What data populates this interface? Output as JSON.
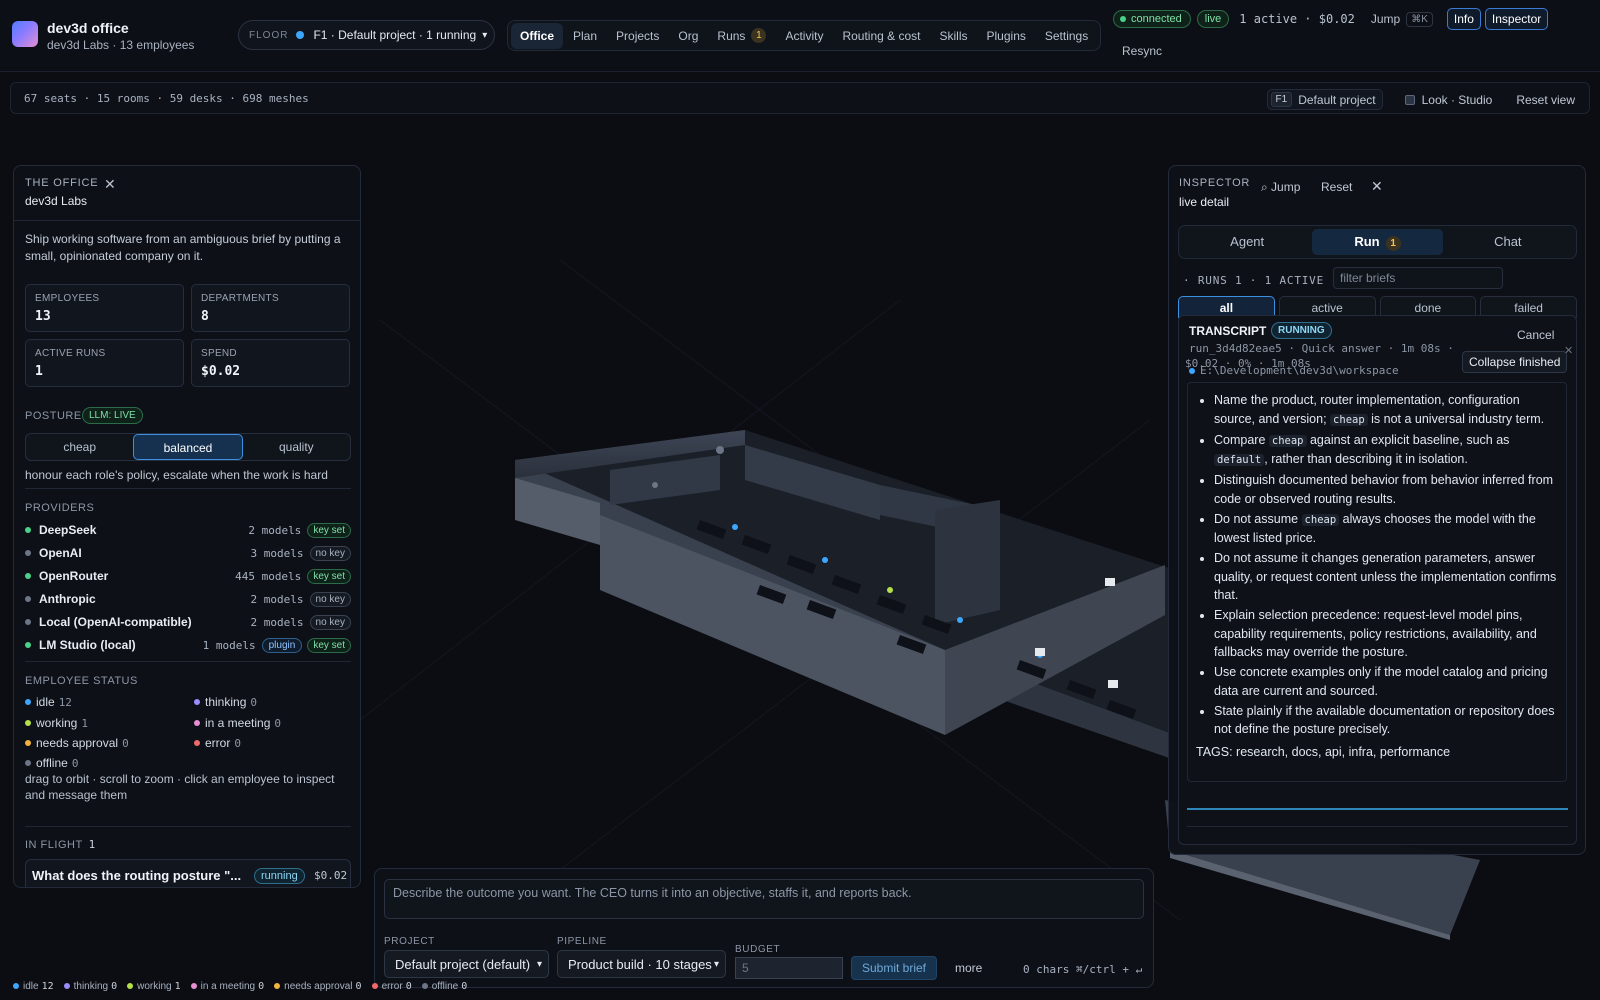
{
  "app": {
    "title": "dev3d office",
    "subtitle": "dev3d Labs · 13 employees",
    "floor_label": "FLOOR",
    "floor_value": "F1 · Default project · 1 running"
  },
  "nav": {
    "tabs": [
      {
        "label": "Office",
        "active": true
      },
      {
        "label": "Plan"
      },
      {
        "label": "Projects"
      },
      {
        "label": "Org"
      },
      {
        "label": "Runs",
        "badge": "1"
      },
      {
        "label": "Activity"
      },
      {
        "label": "Routing & cost"
      },
      {
        "label": "Skills"
      },
      {
        "label": "Plugins"
      },
      {
        "label": "Settings"
      }
    ]
  },
  "status": {
    "connected": "connected",
    "live": "live",
    "active_summary": "1 active · $0.02",
    "jump": "Jump",
    "jump_kbd": "⌘K",
    "info": "Info",
    "inspector": "Inspector",
    "resync": "Resync"
  },
  "subbar": {
    "stats": "67 seats · 15 rooms · 59 desks · 698 meshes",
    "floor_chip": "F1",
    "project": "Default project",
    "look": "Look · Studio",
    "reset_view": "Reset view"
  },
  "office": {
    "eyebrow": "THE OFFICE",
    "name": "dev3d Labs",
    "description": "Ship working software from an ambiguous brief by putting a small, opinionated company on it.",
    "stats": [
      {
        "label": "EMPLOYEES",
        "value": "13"
      },
      {
        "label": "DEPARTMENTS",
        "value": "8"
      },
      {
        "label": "ACTIVE RUNS",
        "value": "1"
      },
      {
        "label": "SPEND",
        "value": "$0.02"
      }
    ],
    "posture_label": "POSTURE",
    "llm_badge": "LLM: LIVE",
    "posture_options": [
      "cheap",
      "balanced",
      "quality"
    ],
    "posture_selected": "balanced",
    "posture_note": "honour each role's policy, escalate when the work is hard",
    "providers_label": "PROVIDERS",
    "providers": [
      {
        "name": "DeepSeek",
        "models": "2 models",
        "key": "key set",
        "has_key": true,
        "color": "#4ad18a"
      },
      {
        "name": "OpenAI",
        "models": "3 models",
        "key": "no key",
        "has_key": false,
        "color": "#6d7686"
      },
      {
        "name": "OpenRouter",
        "models": "445 models",
        "key": "key set",
        "has_key": true,
        "color": "#4ad18a"
      },
      {
        "name": "Anthropic",
        "models": "2 models",
        "key": "no key",
        "has_key": false,
        "color": "#6d7686"
      },
      {
        "name": "Local (OpenAI-compatible)",
        "models": "2 models",
        "key": "no key",
        "has_key": false,
        "color": "#6d7686"
      },
      {
        "name": "LM Studio (local)",
        "models": "1 models",
        "plugin": "plugin",
        "key": "key set",
        "has_key": true,
        "color": "#4ad18a"
      }
    ],
    "employee_status_label": "EMPLOYEE STATUS",
    "employee_status": [
      {
        "label": "idle",
        "count": "12",
        "color": "#3da7ff"
      },
      {
        "label": "thinking",
        "count": "0",
        "color": "#9b8cff"
      },
      {
        "label": "working",
        "count": "1",
        "color": "#b6e04a"
      },
      {
        "label": "in a meeting",
        "count": "0",
        "color": "#e58fd2"
      },
      {
        "label": "needs approval",
        "count": "0",
        "color": "#f1b43c"
      },
      {
        "label": "error",
        "count": "0",
        "color": "#f06a6a"
      },
      {
        "label": "offline",
        "count": "0",
        "color": "#6d7686"
      }
    ],
    "hint": "drag to orbit · scroll to zoom · click an employee to inspect and message them",
    "in_flight_label": "IN FLIGHT",
    "in_flight_count": "1",
    "in_flight": {
      "title": "What does the routing posture \"...",
      "status": "running",
      "cost": "$0.02"
    }
  },
  "inspector": {
    "eyebrow": "INSPECTOR",
    "sub": "live detail",
    "jump": "⌕ Jump",
    "reset": "Reset",
    "tabs": [
      {
        "label": "Agent"
      },
      {
        "label": "Run",
        "badge": "1",
        "active": true
      },
      {
        "label": "Chat"
      }
    ],
    "runs_label": "· RUNS 1 · 1 ACTIVE",
    "filter_placeholder": "filter briefs",
    "filters": [
      "all",
      "active",
      "done",
      "failed"
    ],
    "filter_selected": "all",
    "transcript": {
      "title": "TRANSCRIPT",
      "status": "RUNNING",
      "cancel": "Cancel",
      "meta": "run_3d4d82eae5 · Quick answer · 1m 08s ·",
      "meta2": "$0.02 · 0% · 1m 08s",
      "path": "E:\\Development\\dev3d\\workspace",
      "collapse": "Collapse finished",
      "bullets": [
        {
          "before": "Name the product, router implementation, configuration source, and version; ",
          "code": "cheap",
          "after": " is not a universal industry term."
        },
        {
          "before": "Compare ",
          "code": "cheap",
          "after": " against an explicit baseline, such as ",
          "code2": "default",
          "after2": ", rather than describing it in isolation."
        },
        {
          "before": "Distinguish documented behavior from behavior inferred from code or observed routing results."
        },
        {
          "before": "Do not assume ",
          "code": "cheap",
          "after": " always chooses the model with the lowest listed price."
        },
        {
          "before": "Do not assume it changes generation parameters, answer quality, or request content unless the implementation confirms that."
        },
        {
          "before": "Explain selection precedence: request-level model pins, capability requirements, policy restrictions, availability, and fallbacks may override the posture."
        },
        {
          "before": "Use concrete examples only if the model catalog and pricing data are current and sourced."
        },
        {
          "before": "State plainly if the available documentation or repository does not define the posture precisely."
        }
      ],
      "tags": "TAGS: research, docs, api, infra, performance"
    }
  },
  "composer": {
    "placeholder": "Describe the outcome you want. The CEO turns it into an objective, staffs it, and reports back.",
    "project_label": "PROJECT",
    "project_value": "Default project (default)",
    "pipeline_label": "PIPELINE",
    "pipeline_value": "Product build · 10 stages",
    "budget_label": "BUDGET",
    "budget_placeholder": "5",
    "submit": "Submit brief",
    "more": "more",
    "chars": "0 chars ⌘/ctrl + ↵"
  },
  "bottom_status": [
    {
      "label": "idle",
      "count": "12",
      "color": "#3da7ff"
    },
    {
      "label": "thinking",
      "count": "0",
      "color": "#9b8cff"
    },
    {
      "label": "working",
      "count": "1",
      "color": "#b6e04a"
    },
    {
      "label": "in a meeting",
      "count": "0",
      "color": "#e58fd2"
    },
    {
      "label": "needs approval",
      "count": "0",
      "color": "#f1b43c"
    },
    {
      "label": "error",
      "count": "0",
      "color": "#f06a6a"
    },
    {
      "label": "offline",
      "count": "0",
      "color": "#6d7686"
    }
  ]
}
